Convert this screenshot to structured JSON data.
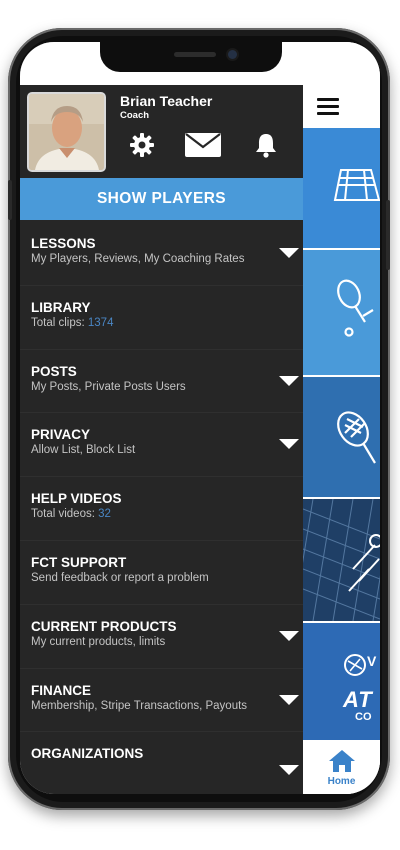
{
  "profile": {
    "name": "Brian Teacher",
    "role": "Coach"
  },
  "icons": {
    "settings": "gear-icon",
    "mail": "mail-icon",
    "notifications": "bell-icon",
    "menu": "hamburger-icon",
    "home": "home-icon"
  },
  "show_players_label": "SHOW PLAYERS",
  "menu": [
    {
      "title": "LESSONS",
      "subtitle": "My Players, Reviews, My Coaching Rates"
    },
    {
      "title": "LIBRARY",
      "subtitle": "Total clips: ",
      "count": "1374"
    },
    {
      "title": "POSTS",
      "subtitle": "My Posts, Private Posts Users"
    },
    {
      "title": "PRIVACY",
      "subtitle": "Allow List, Block List"
    },
    {
      "title": "HELP VIDEOS",
      "subtitle": "Total videos: ",
      "count": "32"
    },
    {
      "title": "FCT SUPPORT",
      "subtitle": "Send feedback or report a problem"
    },
    {
      "title": "CURRENT PRODUCTS",
      "subtitle": "My current products, limits"
    },
    {
      "title": "FINANCE",
      "subtitle": "Membership, Stripe Transactions, Payouts"
    },
    {
      "title": "ORGANIZATIONS",
      "subtitle": ""
    }
  ],
  "right_panel": {
    "logo_text_1": "V",
    "logo_text_2": "AT",
    "logo_text_3": "CO"
  },
  "bottom_tab": {
    "label": "Home"
  },
  "colors": {
    "drawer_bg": "#262626",
    "accent_blue": "#4a9ad9",
    "count_blue": "#4a86c4",
    "tile_blue": "#3a8ad6"
  }
}
